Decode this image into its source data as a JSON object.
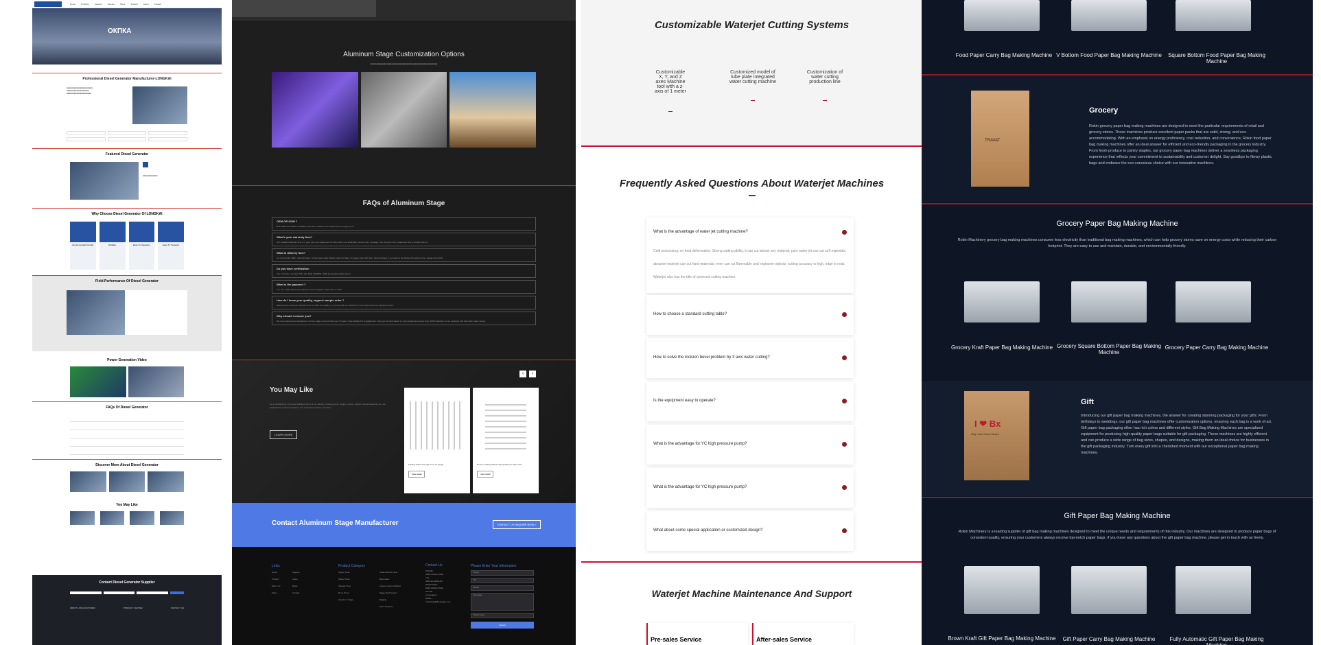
{
  "p1": {
    "nav": [
      "Home",
      "Products",
      "Solution",
      "Service",
      "News",
      "Support",
      "About",
      "Contact"
    ],
    "hero_text": "ОКПКА",
    "about_title": "Professional Diesel Generator Manufacturer-LONGKAI",
    "featured_title": "Featured Diesel Generator",
    "why_title": "Why Choose Diesel Generator Of LONGKAI",
    "why_items": [
      "Environmental Friendly",
      "Reliable",
      "Easy To Operation",
      "Easy To Transport"
    ],
    "field_title": "Field Performance Of Diesel Generator",
    "video_title": "Power Generation Video",
    "faq_title": "FAQs Of Diesel Generator",
    "discover_title": "Discover More About Diesel Generator",
    "may_like": "You May Like",
    "contact_title": "Contact Diesel Generator Supplier",
    "footer_cols": [
      "ABOUT LONGKAI POWER",
      "PRODUCT CENTER",
      "CONTACT US"
    ]
  },
  "p2": {
    "custom_title": "Aluminum Stage Customization Options",
    "faq_title": "FAQs of Aluminum Stage",
    "faqs": [
      {
        "q": "OEM OR ODM ?",
        "a": "Both OEM and ODM is available, we have a skilled R & D department to support you."
      },
      {
        "q": "What's your warranty time?",
        "a": "Our standard warranty time is 1 year, give you replacement for free within one week after receive your message if we bring the loss, please feel free to contact with us."
      },
      {
        "q": "What is delivery time?",
        "a": "For truss under 200m, about 15 days; for laminate under 100pcs, about 10 days; for stage under 100 sqm, about 10 days, if you want to the further the delivery time, please tell us first."
      },
      {
        "q": "Do you have certification",
        "a": "Yes, of course, we have TUV, CE, SGS, ISO9001: 2015 and quality testing report."
      },
      {
        "q": "What is the payment ?",
        "a": "T/T, L/C, Trade Assurance, Western Union, Paypal, Credit Card or Cash."
      },
      {
        "q": "How do I know your quality, support sample order ?",
        "a": "Welcome you send your friends come to check our quality, or you can visit our customer in your local or send us sample to test it."
      },
      {
        "q": "Why should I choose you?",
        "a": "We are professional manufacturer of truss, stage and led trusle over 10 years, have skilled R & D department. Give you the best based on your requirement at any time, 100% attention on our customer and help them make money."
      }
    ],
    "you_may_like": "You May Like",
    "yml_text": "As a manufacturer of the best building blocks of our industry, including truss, staging, screen, electric hoist and lead tilt, etc. are dedicated for product excellence and continuous product innovation.",
    "learn_more": "LEARN MORE",
    "products": [
      "Folding Plated Pre Rig Truss for Stage",
      "Heavy Loading Plated High Quality Pre Rig Truss"
    ],
    "view_detail": "View detail",
    "contact_banner": "Contact Aluminum Stage Manufacturer",
    "contact_btn": "CONTACT US INQUIRE NOW »",
    "footer": {
      "links_title": "Links",
      "links": [
        "Home",
        "Product",
        "About Us",
        "Video",
        "Support",
        "Video",
        "News",
        "Contact"
      ],
      "cat_title": "Product Category",
      "cats": [
        "Spigot Truss",
        "Plated Truss",
        "Spiegal Truss",
        "Done Truss",
        "Aluminum Stage",
        "Chain Electric Hoist",
        "Barricades",
        "Cinesel Control Winder",
        "Stage Roof System",
        "Rigging",
        "More Products"
      ],
      "contact_title": "Contact Us",
      "contact_lines": [
        "PHONE :",
        "0086-13630147991",
        "TEL :",
        "0086-20-34802457",
        "WHATSAPP :",
        "0086-13630147991",
        "SKYPE :",
        "Lihuastage2",
        "EMAIL :",
        "marketing@lihuastage.com"
      ],
      "form_title": "Please Enter Your Information",
      "fields": [
        "*Name",
        "*Tel",
        "*Email",
        "*Message",
        "*Verify Code"
      ],
      "submit": "Submit"
    }
  },
  "p3": {
    "title1": "Customizable Waterjet Cutting Systems",
    "cols": [
      "Customizable X, Y, and Z axes Machine tool with a z-axis of 1 meter",
      "Customized model of tube plate integrated water cutting machine",
      "Customization of water cutting production line"
    ],
    "faq_title": "Frequently Asked Questions About Waterjet Machines",
    "faq": [
      {
        "q": "What is the advantage of water jet cutting machine?",
        "a": "Cold processing, no heat deformation: Strong cutting ability, it can cut almost any material; pure water jet can cut soft materials, abrasive waterjet can cut hard materials, even can cut flammable and explosive objects; cutting accuracy is high, edge is neat. Waterjet also has the title of universal cutting machine."
      },
      {
        "q": "How to choose a standard cutting table?"
      },
      {
        "q": "How to solve the incision bevel problem by 3 axis water cutting?"
      },
      {
        "q": "Is the equipment easy to operate?"
      },
      {
        "q": "What is the advantage for YC high pressure pump?"
      },
      {
        "q": "What is the advantage for YC high pressure pump?"
      },
      {
        "q": "What about some special application or customized design?"
      }
    ],
    "maint_title": "Waterjet Machine Maintenance And Support",
    "services": [
      "Pre-sales Service",
      "After-sales Service"
    ]
  },
  "p4": {
    "top_caps": [
      "Food Paper Carry Bag Making Machine",
      "V Bottom Food Paper Bag Making Machine",
      "Square Bottom Food Paper Bag Making Machine"
    ],
    "grocery_title": "Grocery",
    "grocery_text": "Rokin grocery paper bag making machines are designed to meet the particular requirements of retail and grocery stores. These machines produce excellent paper packs that are solid, strong, and eco-accommodating. With an emphasis on energy proficiency, cost reduction, and convenience, Rokin food paper bag making machines offer an ideal answer for efficient and eco-friendly packaging in the grocery industry. From fresh produce to pantry staples, our grocery paper bag machines deliver a seamless packaging experience that reflects your commitment to sustainability and customer delight. Say goodbye to flimsy plastic bags and embrace the eco-conscious choice with our innovative machines.",
    "bag_brand": "TRAVAT",
    "gpm_title": "Grocery Paper Bag Making Machine",
    "gpm_text": "Rokin Machinery grocery bag making machines consume less electricity than traditional bag making machines, which can help grocery stores save on energy costs while reducing their carbon footprint. They are easy to use and maintain, durable, and environmentally friendly.",
    "gpm_caps": [
      "Grocery Kraft Paper Bag Making Machine",
      "Grocery Square Bottom Paper Bag Making Machine",
      "Grocery Paper Carry Bag Making Machine"
    ],
    "gift_title": "Gift",
    "gift_text": "Introducing our gift paper bag making machines, the answer for creating stunning packaging for your gifts. From birthdays to weddings, our gift paper bag machines offer customization options, ensuring each bag is a work of art. Gift paper bag packaging often has rich colors and different styles. Gift Bag Making Machines are specialized equipment for producing high-quality paper bags suitable for gift packaging. These machines are highly efficient and can produce a wide range of bag sizes, shapes, and designs, making them an ideal choice for businesses in the gift packaging industry. Turn every gift into a cherished moment with our exceptional paper bag making machines.",
    "gift_bag_text": "I ❤ Bx",
    "gift_bag_sub": "Step Your Heart Desire",
    "gpbm_title": "Gift Paper Bag Making Machine",
    "gpbm_text": "Rokin Machinery is a leading supplier of gift bag making machines designed to meet the unique needs and requirements of this industry. Our machines are designed to produce paper bags of consistent quality, ensuring your customers always receive top-notch paper bags. If you have any questions about the gift paper bag machine, please get in touch with us freely.",
    "gpbm_caps": [
      "Brown Kraft Gift Paper Bag Making Machine",
      "Gift Paper Carry Bag Making Machine",
      "Fully Automatic Gift Paper Bag Making Machine"
    ]
  },
  "colors": {
    "accent_red": "#c8102e",
    "blue": "#4f7ae6",
    "navy": "#0e1626"
  }
}
